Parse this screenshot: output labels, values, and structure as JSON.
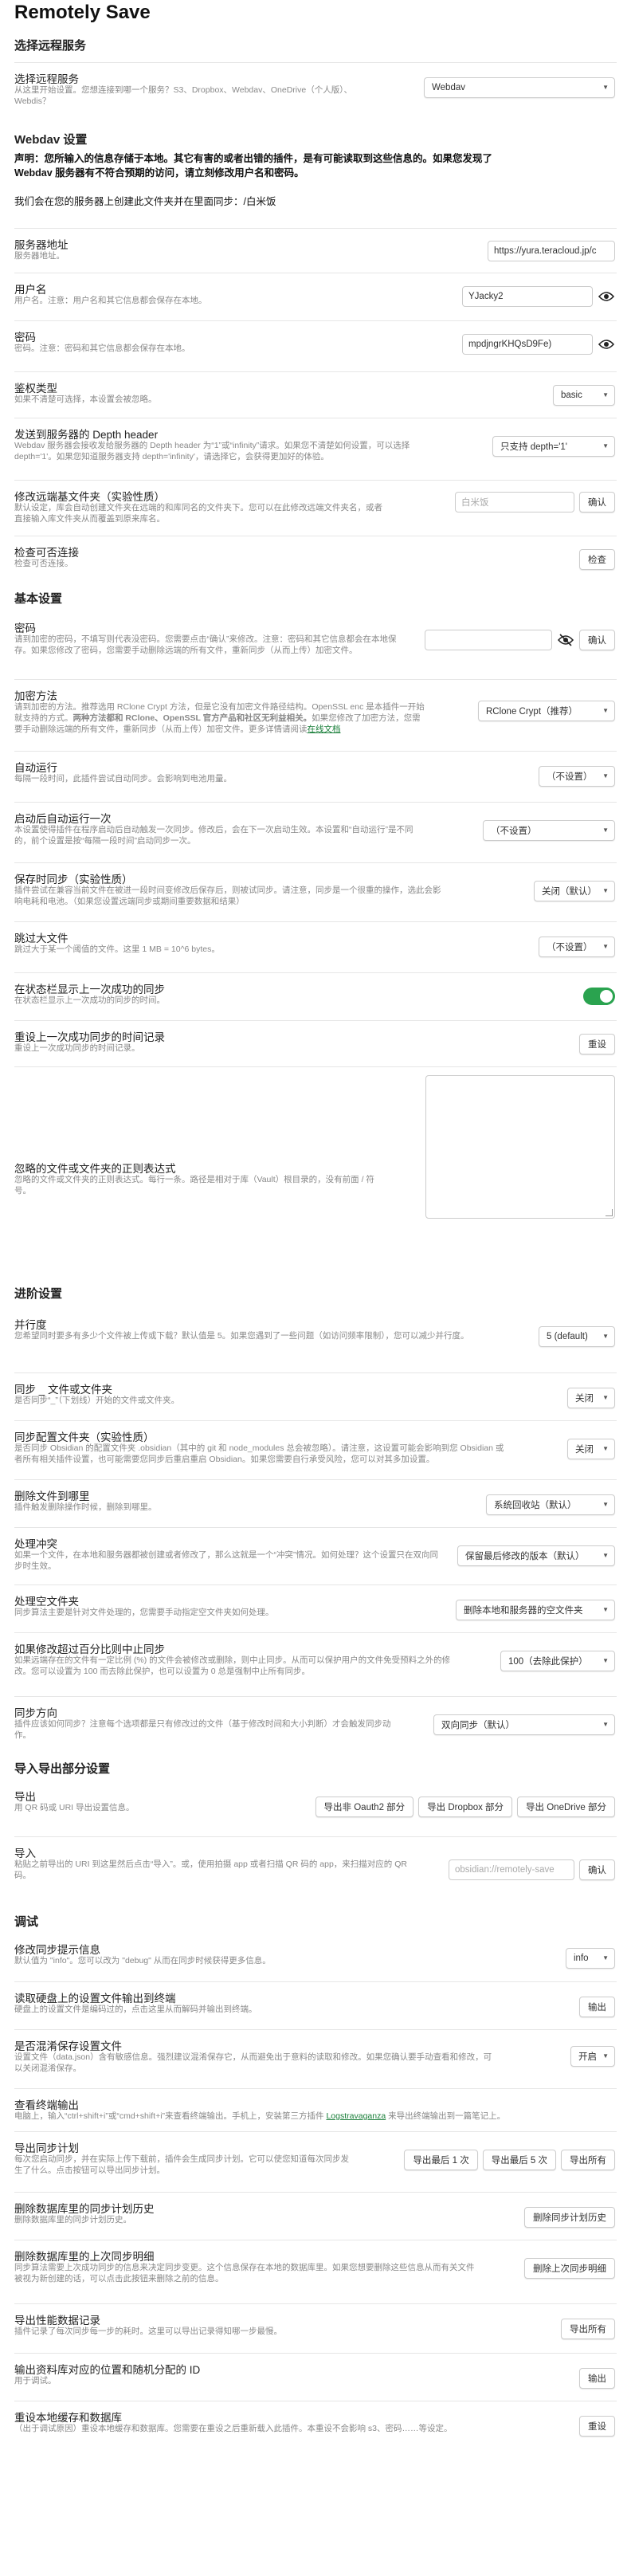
{
  "page_title": "Remotely Save",
  "sections": {
    "remote": "选择远程服务",
    "webdav": "Webdav 设置",
    "basic": "基本设置",
    "advanced": "进阶设置",
    "importexport": "导入导出部分设置",
    "debug": "调试"
  },
  "remote_service": {
    "name": "选择远程服务",
    "desc": "从这里开始设置。您想连接到哪一个服务？S3、Dropbox、Webdav、OneDrive（个人版）、Webdis？",
    "value": "Webdav"
  },
  "webdav_notice": {
    "line1": "声明：您所输入的信息存储于本地。其它有害的或者出错的插件，是有可能读取到这些信息的。如果您发现了",
    "line2": "Webdav 服务器有不符合预期的访问，请立刻修改用户名和密码。",
    "line3": "我们会在您的服务器上创建此文件夹并在里面同步：/白米饭"
  },
  "server_address": {
    "name": "服务器地址",
    "desc": "服务器地址。",
    "value": "https://yura.teracloud.jp/c"
  },
  "username": {
    "name": "用户名",
    "desc": "用户名。注意：用户名和其它信息都会保存在本地。",
    "value": "YJacky2"
  },
  "password": {
    "name": "密码",
    "desc": "密码。注意：密码和其它信息都会保存在本地。",
    "value": "mpdjngrKHQsD9Fe)"
  },
  "auth_type": {
    "name": "鉴权类型",
    "desc": "如果不清楚可选择，本设置会被忽略。",
    "value": "basic"
  },
  "depth": {
    "name": "发送到服务器的 Depth header",
    "desc": "Webdav 服务器会接收发给服务器的 Depth header 为“1”或“infinity”请求。如果您不清楚如何设置，可以选择 depth='1'。如果您知道服务器支持 depth='infinity'，请选择它，会获得更加好的体验。",
    "value": "只支持 depth='1'"
  },
  "remote_folder": {
    "name": "修改远端基文件夹（实验性质）",
    "desc": "默认设定，库会自动创建文件夹在远端的和库同名的文件夹下。您可以在此修改远端文件夹名，或者直接输入库文件夹从而覆盖到原来库名。",
    "placeholder": "白米饭",
    "confirm": "确认"
  },
  "check_connection": {
    "name": "检查可否连接",
    "desc": "检查可否连接。",
    "button": "检查"
  },
  "encryption_password": {
    "name": "密码",
    "desc": "请到加密的密码，不填写则代表没密码。您需要点击“确认”来修改。注意：密码和其它信息都会在本地保存。如果您修改了密码，您需要手动删除远端的所有文件，重新同步（从而上传）加密文件。",
    "confirm": "确认"
  },
  "encryption_method": {
    "name": "加密方法",
    "desc1": "请到加密的方法。推荐选用 RClone Crypt 方法，但是它没有加密文件路径结构。OpenSSL enc 是本插件一开始就支持的方式。",
    "desc_bold": "两种方法都和 RClone、OpenSSL 官方产品和社区无利益相关。",
    "desc2": "如果您修改了加密方法，您需要手动删除远端的所有文件，重新同步（从而上传）加密文件。更多详情请阅读",
    "desc_link": "在线文档",
    "value": "RClone Crypt（推荐）"
  },
  "auto_run": {
    "name": "自动运行",
    "desc": "每隔一段时间，此插件尝试自动同步。会影响到电池用量。",
    "value": "（不设置）"
  },
  "startup_run": {
    "name": "启动后自动运行一次",
    "desc": "本设置使得插件在程序启动后自动触发一次同步。修改后，会在下一次启动生效。本设置和“自动运行”是不同的，前个设置是按“每隔一段时间”启动同步一次。",
    "value": "（不设置）"
  },
  "save_sync": {
    "name": "保存时同步（实验性质）",
    "desc": "插件尝试在兼容当前文件在被进一段时间变修改后保存后，则被试同步。请注意，同步是一个很重的操作，选此会影响电耗和电池。（如果您设置远端同步或期间重要数据和结果）",
    "value": "关闭（默认）"
  },
  "skip_large": {
    "name": "跳过大文件",
    "desc": "跳过大于某一个阈值的文件。这里 1 MB = 10^6 bytes。",
    "value": "（不设置）"
  },
  "status_bar": {
    "name": "在状态栏显示上一次成功的同步",
    "desc": "在状态栏显示上一次成功的同步的时间。"
  },
  "reset_last": {
    "name": "重设上一次成功同步的时间记录",
    "desc": "重设上一次成功同步的时间记录。",
    "button": "重设"
  },
  "ignore_paths": {
    "name": "忽略的文件或文件夹的正则表达式",
    "desc": "忽略的文件或文件夹的正则表达式。每行一条。路径是相对于库（Vault）根目录的，没有前面 / 符号。"
  },
  "concurrency": {
    "name": "并行度",
    "desc": "您希望同时要多有多少个文件被上传或下载？默认值是 5。如果您遇到了一些问题（如访问频率限制），您可以减少并行度。",
    "value": "5 (default)"
  },
  "sync_underscore": {
    "name": "同步 _ 文件或文件夹",
    "desc": "是否同步“_”（下划线）开始的文件或文件夹。",
    "value": "关闭"
  },
  "sync_config": {
    "name": "同步配置文件夹（实验性质）",
    "desc": "是否同步 Obsidian 的配置文件夹 .obsidian（其中的 git 和 node_modules 总会被忽略）。请注意，这设置可能会影响到您 Obsidian 或者所有相关插件设置，也可能需要您同步后重启重启 Obsidian。如果您需要自行承受风险，您可以对其多加设置。",
    "value": "关闭"
  },
  "delete_behavior": {
    "name": "删除文件到哪里",
    "desc": "插件触发删除操作时候，删除到哪里。",
    "value": "系统回收站（默认）"
  },
  "conflict": {
    "name": "处理冲突",
    "desc": "如果一个文件，在本地和服务器都被创建或者修改了，那么这就是一个“冲突”情况。如何处理？这个设置只在双向同步时生效。",
    "value": "保留最后修改的版本（默认）"
  },
  "empty_folder": {
    "name": "处理空文件夹",
    "desc": "同步算法主要是针对文件处理的，您需要手动指定空文件夹如何处理。",
    "value": "删除本地和服务器的空文件夹"
  },
  "abort_percent": {
    "name": "如果修改超过百分比则中止同步",
    "desc": "如果远端存在的文件有一定比例 (%) 的文件会被修改或删除，则中止同步。从而可以保护用户的文件免受预料之外的修改。您可以设置为 100 而去除此保护，也可以设置为 0 总是强制中止所有同步。",
    "value": "100（去除此保护）"
  },
  "sync_direction": {
    "name": "同步方向",
    "desc": "插件应该如何同步？注意每个选项都是只有修改过的文件（基于修改时间和大小判断）才会触发同步动作。",
    "value": "双向同步（默认）"
  },
  "export": {
    "name": "导出",
    "desc": "用 QR 码或 URI 导出设置信息。",
    "btn1": "导出非 Oauth2 部分",
    "btn2": "导出 Dropbox 部分",
    "btn3": "导出 OneDrive 部分"
  },
  "import": {
    "name": "导入",
    "desc": "粘贴之前导出的 URI 到这里然后点击“导入”。或，使用拍摄 app 或者扫描 QR 码的 app，来扫描对应的 QR 码。",
    "placeholder": "obsidian://remotely-save",
    "confirm": "确认"
  },
  "log_level": {
    "name": "修改同步提示信息",
    "desc": "默认值为 \"info\"。您可以改为 \"debug\" 从而在同步时候获得更多信息。",
    "value": "info"
  },
  "read_settings": {
    "name": "读取硬盘上的设置文件输出到终端",
    "desc": "硬盘上的设置文件是编码过的，点击这里从而解码并输出到终端。",
    "button": "输出"
  },
  "save_settings": {
    "name": "是否混淆保存设置文件",
    "desc": "设置文件（data.json）含有敏感信息。强烈建议混淆保存它，从而避免出于意料的读取和修改。如果您确认要手动查看和修改，可以关闭混淆保存。",
    "value": "开启"
  },
  "view_console": {
    "name": "查看终端输出",
    "desc_a": "电脑上，输入“ctrl+shift+i”或“cmd+shift+i”来查看终端输出。手机上，安装第三方插件",
    "desc_link": "Logstravaganza",
    "desc_b": "来导出终端输出到一篇笔记上。"
  },
  "export_history": {
    "name": "导出同步计划",
    "desc": "每次您启动同步，并在实际上传下载前，插件会生成同步计划。它可以使您知道每次同步发生了什么。点击按钮可以导出同步计划。",
    "btn1": "导出最后 1 次",
    "btn2": "导出最后 5 次",
    "btn3": "导出所有"
  },
  "delete_history": {
    "name": "删除数据库里的同步计划历史",
    "desc": "删除数据库里的同步计划历史。",
    "button": "删除同步计划历史"
  },
  "delete_prev_sync": {
    "name": "删除数据库里的上次同步明细",
    "desc": "同步算法需要上次成功同步的信息来决定同步变更。这个信息保存在本地的数据库里。如果您想要删除这些信息从而有关文件被视为新创建的话，可以点击此按钮来删除之前的信息。",
    "button": "删除上次同步明细"
  },
  "export_profiler": {
    "name": "导出性能数据记录",
    "desc": "插件记录了每次同步每一步的耗时。这里可以导出记录得知哪一步最慢。",
    "button": "导出所有"
  },
  "output_vault_id": {
    "name": "输出资料库对应的位置和随机分配的 ID",
    "desc": "用于调试。",
    "button": "输出"
  },
  "reset_cache": {
    "name": "重设本地缓存和数据库",
    "desc": "（出于调试原因）重设本地缓存和数据库。您需要在重设之后重新载入此插件。本重设不会影响 s3、密码……等设定。",
    "button": "重设"
  }
}
